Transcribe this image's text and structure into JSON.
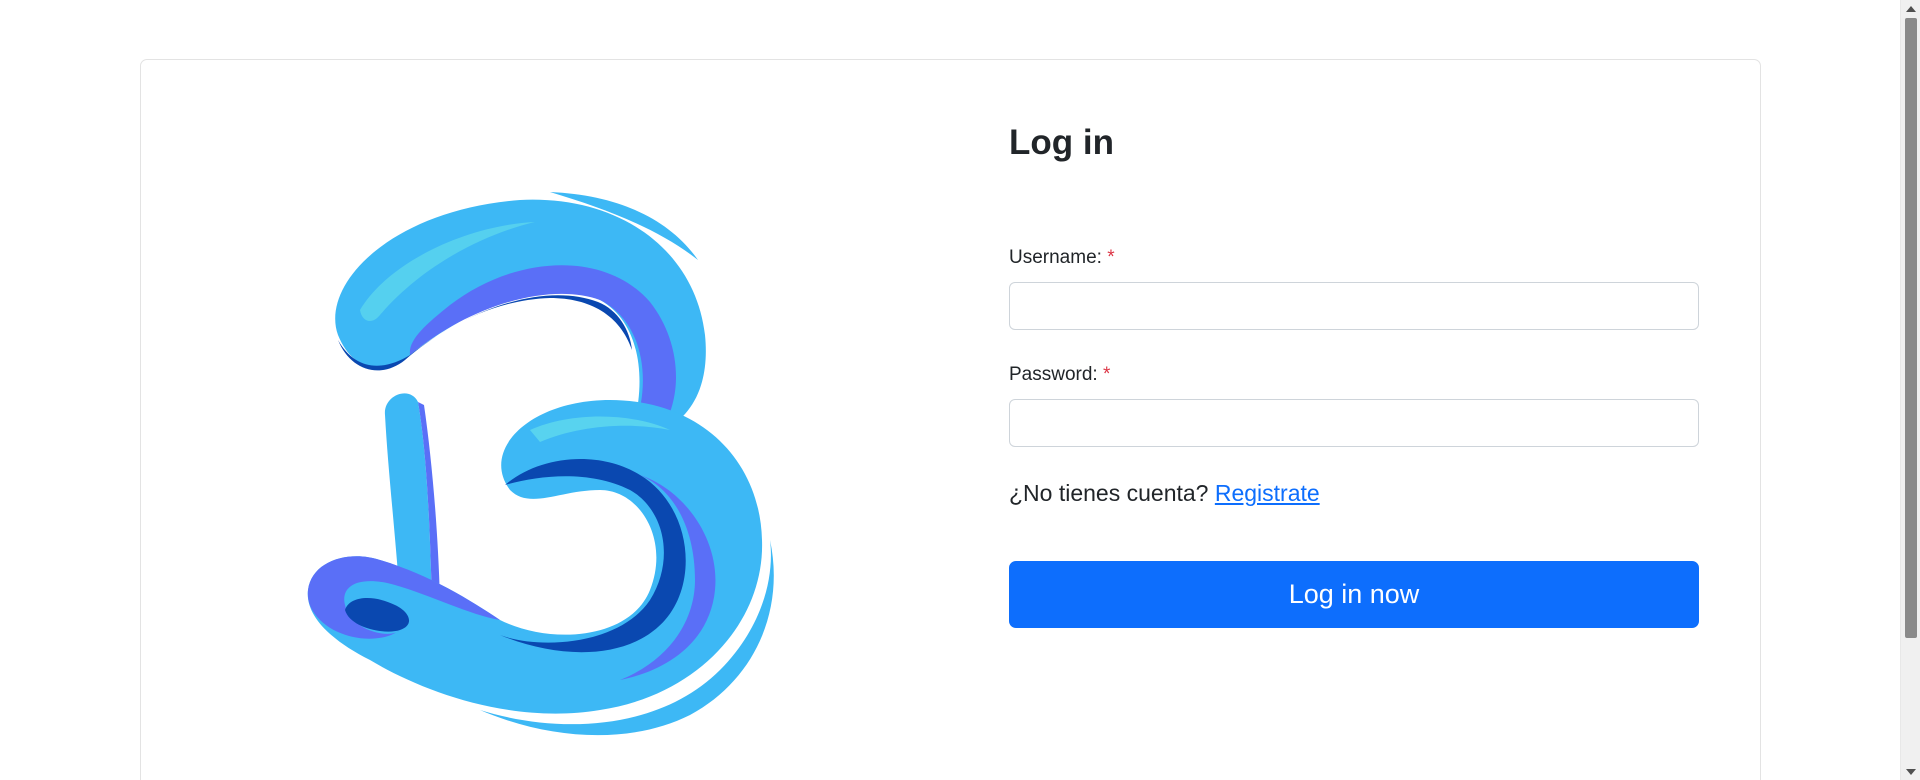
{
  "login": {
    "title": "Log in",
    "username_label": "Username:",
    "password_label": "Password:",
    "required_mark": "*",
    "username_value": "",
    "password_value": "",
    "no_account_text": "¿No tienes cuenta?",
    "register_link": "Registrate",
    "submit_label": "Log in now"
  },
  "logo": {
    "icon": "letter-b-logo-icon",
    "colors": [
      "#3db8f5",
      "#5a6ff7",
      "#0a48b0",
      "#5bd6ee"
    ]
  },
  "theme": {
    "primary": "#0d6efd",
    "required": "#dc3545",
    "text": "#212529",
    "border": "#ced4da"
  }
}
